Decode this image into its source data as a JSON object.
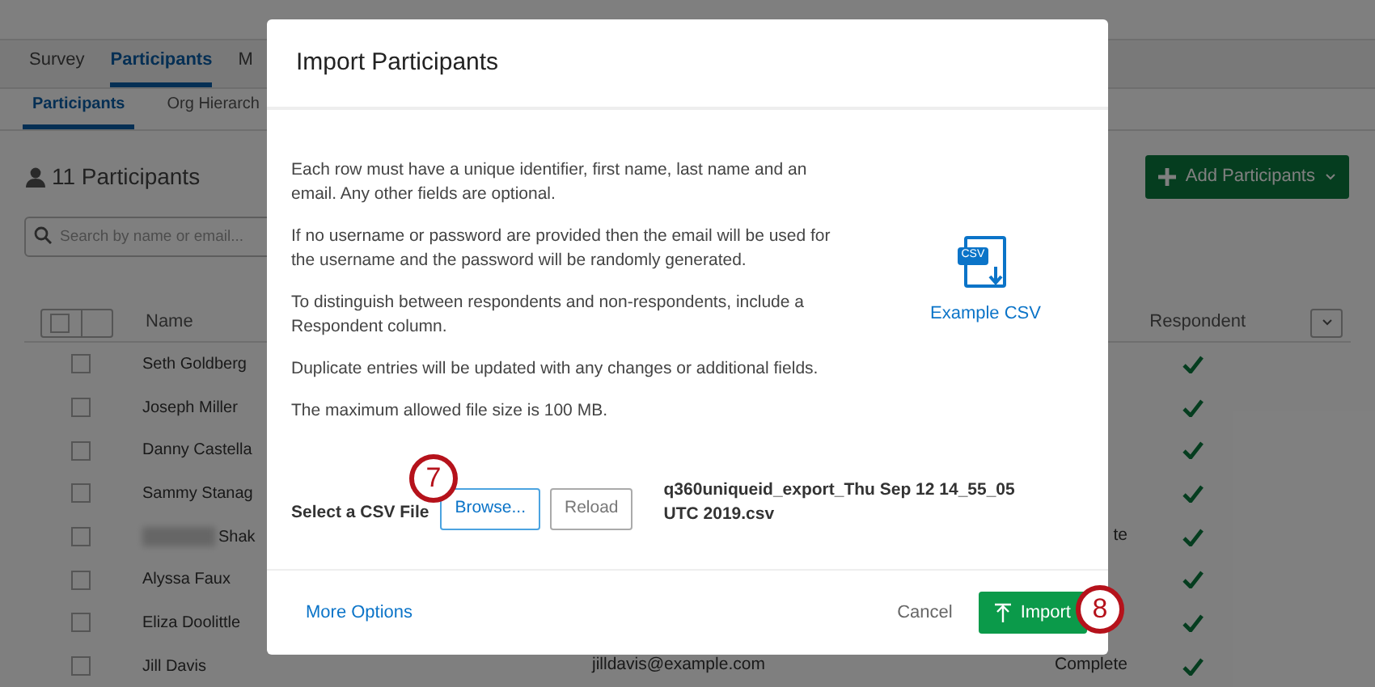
{
  "tabs": [
    {
      "label": "Survey",
      "selected": false
    },
    {
      "label": "Participants",
      "selected": true
    },
    {
      "label": "M",
      "selected": false
    }
  ],
  "subtabs": [
    {
      "label": "Participants",
      "selected": true
    },
    {
      "label": "Org Hierarch",
      "selected": false
    }
  ],
  "participants_title": "11 Participants",
  "add_button": "Add Participants",
  "search": {
    "placeholder": "Search by name or email..."
  },
  "select_all_checked": false,
  "table": {
    "columns": [
      "Name",
      "Respondent"
    ],
    "rows": [
      {
        "name": "Seth Goldberg",
        "checked": false,
        "redacted": false,
        "email": "",
        "status": "",
        "respondent": true
      },
      {
        "name": "Joseph Miller",
        "checked": false,
        "redacted": false,
        "email": "",
        "status": "",
        "respondent": true
      },
      {
        "name": "Danny Castella",
        "checked": false,
        "redacted": false,
        "email": "",
        "status": "",
        "respondent": true
      },
      {
        "name": "Sammy Stanag",
        "checked": false,
        "redacted": false,
        "email": "",
        "status": "",
        "respondent": true
      },
      {
        "name": "Shak",
        "checked": false,
        "redacted": true,
        "email": "",
        "status": "te",
        "respondent": true
      },
      {
        "name": "Alyssa Faux",
        "checked": false,
        "redacted": false,
        "email": "",
        "status": "",
        "respondent": true
      },
      {
        "name": "Eliza Doolittle",
        "checked": false,
        "redacted": false,
        "email": "",
        "status": "",
        "respondent": true
      },
      {
        "name": "Jill Davis",
        "checked": false,
        "redacted": false,
        "email": "jilldavis@example.com",
        "status": "Complete",
        "respondent": true
      }
    ]
  },
  "dialog": {
    "title": "Import Participants",
    "paragraphs": [
      "Each row must have a unique identifier, first name, last name and an email. Any other fields are optional.",
      "If no username or password are provided then the email will be used for the username and the password will be randomly generated.",
      "To distinguish between respondents and non-respondents, include a Respondent column.",
      "Duplicate entries will be updated with any changes or additional fields.",
      "The maximum allowed file size is 100 MB."
    ],
    "example_link": "Example CSV",
    "icon_label": "CSV",
    "file_label": "Select a CSV File",
    "browse_button": "Browse...",
    "reload_button": "Reload",
    "file_name": "q360uniqueid_export_Thu Sep 12 14_55_05 UTC 2019.csv",
    "more_options": "More Options",
    "cancel": "Cancel",
    "import": "Import"
  },
  "callouts": [
    "7",
    "8"
  ]
}
